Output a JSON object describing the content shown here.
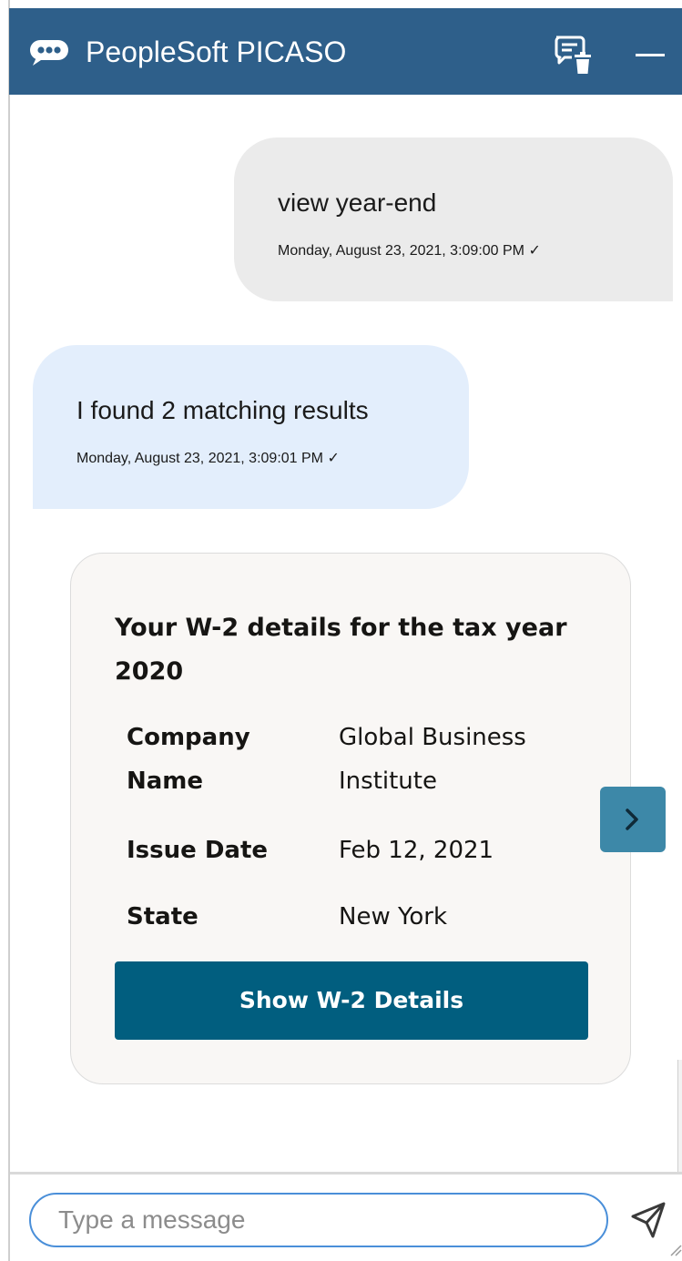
{
  "header": {
    "title": "PeopleSoft PICASO",
    "icons": {
      "bot": "chat-bubble-icon",
      "clear": "clear-conversation-icon",
      "minimize": "minimize-icon"
    },
    "color": "#2e5f8a"
  },
  "messages": [
    {
      "sender": "user",
      "text": "view year-end",
      "timestamp": "Monday, August 23, 2021, 3:09:00 PM ✓"
    },
    {
      "sender": "bot",
      "text": "I found 2 matching results",
      "timestamp": "Monday, August 23, 2021, 3:09:01 PM ✓"
    }
  ],
  "card": {
    "title": "Your W-2 details for the tax year 2020",
    "fields": [
      {
        "label": "Company Name",
        "value": "Global Business Institute"
      },
      {
        "label": "Issue Date",
        "value": "Feb 12, 2021"
      },
      {
        "label": "State",
        "value": "New York"
      }
    ],
    "action_label": "Show W-2 Details",
    "action_color": "#015e7f"
  },
  "carousel": {
    "next_icon": "chevron-right-icon"
  },
  "footer": {
    "input_value": "",
    "input_placeholder": "Type a message",
    "send_icon": "send-icon"
  }
}
